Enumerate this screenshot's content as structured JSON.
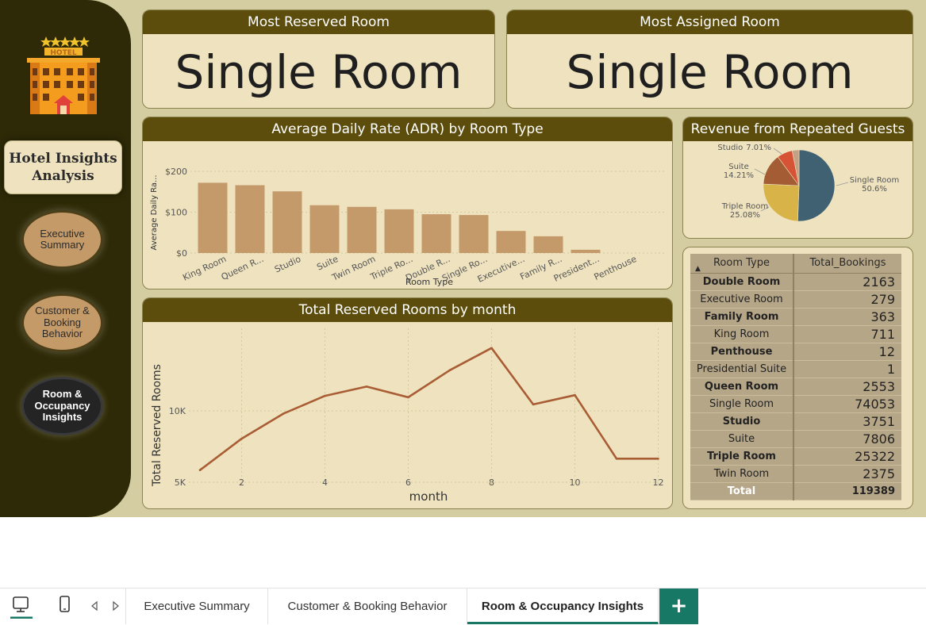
{
  "sidebar": {
    "logo_text": "HOTEL",
    "title_line1": "Hotel Insights",
    "title_line2": "Analysis",
    "nav": [
      {
        "l1": "Executive",
        "l2": "Summary",
        "l3": ""
      },
      {
        "l1": "Customer &",
        "l2": "Booking",
        "l3": "Behavior"
      },
      {
        "l1": "Room &",
        "l2": "Occupancy",
        "l3": "Insights"
      }
    ]
  },
  "kpi": {
    "reserved_title": "Most Reserved Room",
    "reserved_value": "Single Room",
    "assigned_title": "Most Assigned Room",
    "assigned_value": "Single Room"
  },
  "adr_title": "Average Daily Rate (ADR) by Room Type",
  "repeat_title": "Revenue from Repeated Guests",
  "monthly_title": "Total Reserved Rooms by month",
  "chart_data": [
    {
      "type": "bar",
      "title": "Average Daily Rate (ADR) by Room Type",
      "xlabel": "Room Type",
      "ylabel": "Average Daily Ra...",
      "categories": [
        "King Room",
        "Queen R...",
        "Studio",
        "Suite",
        "Twin Room",
        "Triple Ro...",
        "Double R...",
        "Single Ro...",
        "Executive...",
        "Family R...",
        "President...",
        "Penthouse"
      ],
      "values": [
        172,
        166,
        151,
        117,
        113,
        107,
        95,
        93,
        54,
        41,
        8,
        0
      ],
      "yticks": [
        "$0",
        "$100",
        "$200"
      ],
      "ylim": [
        0,
        200
      ],
      "color": "#c49a6b"
    },
    {
      "type": "pie",
      "title": "Revenue from Repeated Guests",
      "slices": [
        {
          "label": "Single Room",
          "pct": "50.6%",
          "value": 50.6,
          "color": "#3f6172"
        },
        {
          "label": "Triple Room",
          "pct": "25.08%",
          "value": 25.08,
          "color": "#d7b348"
        },
        {
          "label": "Suite",
          "pct": "14.21%",
          "value": 14.21,
          "color": "#a45c35"
        },
        {
          "label": "Studio",
          "pct": "7.01%",
          "value": 7.01,
          "color": "#d65336"
        },
        {
          "label": "",
          "pct": "",
          "value": 3.1,
          "color": "#c4a186"
        }
      ]
    },
    {
      "type": "line",
      "title": "Total Reserved Rooms by month",
      "xlabel": "month",
      "ylabel": "Total Reserved Rooms",
      "x": [
        1,
        2,
        3,
        4,
        5,
        6,
        7,
        8,
        9,
        10,
        11,
        12
      ],
      "values": [
        5850,
        8050,
        9800,
        11050,
        11700,
        10950,
        12850,
        14400,
        10450,
        11100,
        6650,
        6650
      ],
      "xticks": [
        "2",
        "4",
        "6",
        "8",
        "10",
        "12"
      ],
      "yticks": [
        "5K",
        "10K"
      ],
      "color": "#a95d35"
    },
    {
      "type": "table",
      "columns": [
        "Room Type",
        "Total_Bookings"
      ],
      "rows": [
        [
          "Double Room",
          "2163"
        ],
        [
          "Executive Room",
          "279"
        ],
        [
          "Family Room",
          "363"
        ],
        [
          "King Room",
          "711"
        ],
        [
          "Penthouse",
          "12"
        ],
        [
          "Presidential Suite",
          "1"
        ],
        [
          "Queen Room",
          "2553"
        ],
        [
          "Single Room",
          "74053"
        ],
        [
          "Studio",
          "3751"
        ],
        [
          "Suite",
          "7806"
        ],
        [
          "Triple Room",
          "25322"
        ],
        [
          "Twin Room",
          "2375"
        ]
      ],
      "total": [
        "Total",
        "119389"
      ]
    }
  ],
  "tabs": [
    "Executive Summary",
    "Customer & Booking Behavior",
    "Room & Occupancy Insights"
  ],
  "add_tab": "+"
}
